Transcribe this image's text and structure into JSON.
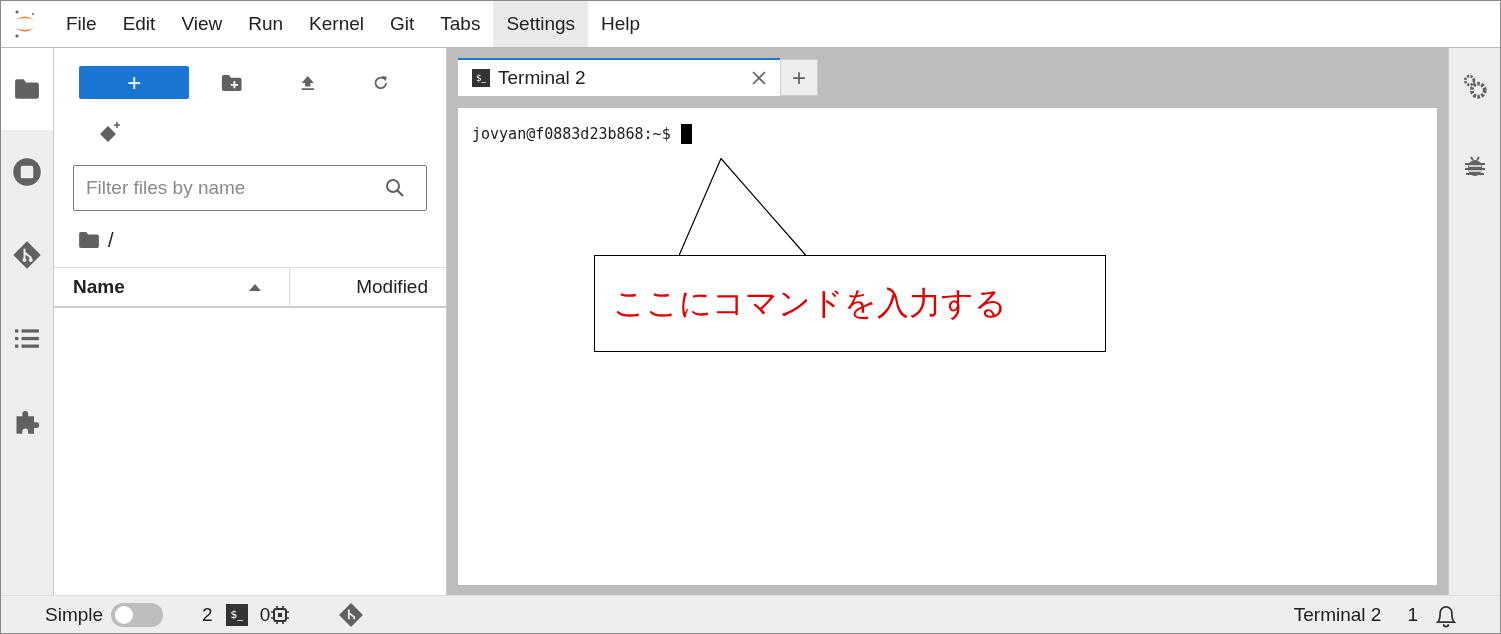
{
  "menu_bar": {
    "items": [
      {
        "label": "File",
        "selected": false
      },
      {
        "label": "Edit",
        "selected": false
      },
      {
        "label": "View",
        "selected": false
      },
      {
        "label": "Run",
        "selected": false
      },
      {
        "label": "Kernel",
        "selected": false
      },
      {
        "label": "Git",
        "selected": false
      },
      {
        "label": "Tabs",
        "selected": false
      },
      {
        "label": "Settings",
        "selected": true
      },
      {
        "label": "Help",
        "selected": false
      }
    ]
  },
  "left_sidebar": {
    "items": [
      {
        "kind": "folder",
        "selected": true
      },
      {
        "kind": "running",
        "selected": false
      },
      {
        "kind": "git",
        "selected": false
      },
      {
        "kind": "toc",
        "selected": false
      },
      {
        "kind": "extensions",
        "selected": false
      }
    ]
  },
  "file_browser": {
    "new_button": "+",
    "filter": {
      "placeholder": "Filter files by name"
    },
    "path": "/",
    "columns": [
      {
        "label": "Name"
      },
      {
        "label": "Modified"
      }
    ]
  },
  "tabs": [
    {
      "icon": "$_",
      "label": "Terminal 2",
      "selected": true
    }
  ],
  "add_tab": "+",
  "terminal": {
    "prompt": "jovyan@f0883d23b868:~$"
  },
  "callout": {
    "text": "ここにコマンドを入力する"
  },
  "status_bar": {
    "simple_label": "Simple",
    "simple_on": false,
    "terminals": "2",
    "terminal_icon": "$_",
    "kernels": "0",
    "current": "Terminal 2",
    "notifications": "1"
  }
}
